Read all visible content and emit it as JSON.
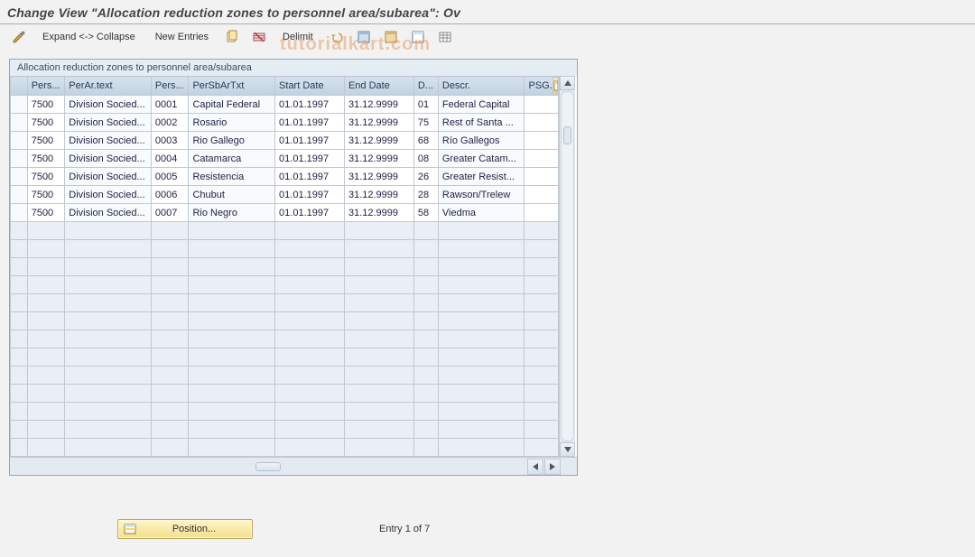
{
  "header": {
    "title": "Change View \"Allocation reduction zones to personnel area/subarea\": Ov"
  },
  "watermark": "tutorialkart.com",
  "toolbar": {
    "expand_collapse": "Expand <-> Collapse",
    "new_entries": "New Entries",
    "delimit": "Delimit"
  },
  "panel": {
    "title": "Allocation reduction zones to personnel area/subarea"
  },
  "columns": [
    {
      "key": "pers_area",
      "label": "Pers..."
    },
    {
      "key": "per_ar_text",
      "label": "PerAr.text"
    },
    {
      "key": "pers_sub",
      "label": "Pers..."
    },
    {
      "key": "per_sb_ar_txt",
      "label": "PerSbArTxt"
    },
    {
      "key": "start_date",
      "label": "Start Date"
    },
    {
      "key": "end_date",
      "label": "End Date"
    },
    {
      "key": "d",
      "label": "D..."
    },
    {
      "key": "descr",
      "label": "Descr."
    },
    {
      "key": "psg",
      "label": "PSG."
    }
  ],
  "rows": [
    {
      "pers_area": "7500",
      "per_ar_text": "Division Socied...",
      "pers_sub": "0001",
      "per_sb_ar_txt": "Capital Federal",
      "start_date": "01.01.1997",
      "end_date": "31.12.9999",
      "d": "01",
      "descr": "Federal Capital",
      "psg": ""
    },
    {
      "pers_area": "7500",
      "per_ar_text": "Division Socied...",
      "pers_sub": "0002",
      "per_sb_ar_txt": "Rosario",
      "start_date": "01.01.1997",
      "end_date": "31.12.9999",
      "d": "75",
      "descr": "Rest of Santa ...",
      "psg": ""
    },
    {
      "pers_area": "7500",
      "per_ar_text": "Division Socied...",
      "pers_sub": "0003",
      "per_sb_ar_txt": "Rio Gallego",
      "start_date": "01.01.1997",
      "end_date": "31.12.9999",
      "d": "68",
      "descr": "Río Gallegos",
      "psg": ""
    },
    {
      "pers_area": "7500",
      "per_ar_text": "Division Socied...",
      "pers_sub": "0004",
      "per_sb_ar_txt": "Catamarca",
      "start_date": "01.01.1997",
      "end_date": "31.12.9999",
      "d": "08",
      "descr": "Greater Catam...",
      "psg": ""
    },
    {
      "pers_area": "7500",
      "per_ar_text": "Division Socied...",
      "pers_sub": "0005",
      "per_sb_ar_txt": "Resistencia",
      "start_date": "01.01.1997",
      "end_date": "31.12.9999",
      "d": "26",
      "descr": "Greater Resist...",
      "psg": ""
    },
    {
      "pers_area": "7500",
      "per_ar_text": "Division Socied...",
      "pers_sub": "0006",
      "per_sb_ar_txt": "Chubut",
      "start_date": "01.01.1997",
      "end_date": "31.12.9999",
      "d": "28",
      "descr": "Rawson/Trelew",
      "psg": ""
    },
    {
      "pers_area": "7500",
      "per_ar_text": "Division Socied...",
      "pers_sub": "0007",
      "per_sb_ar_txt": "Rio Negro",
      "start_date": "01.01.1997",
      "end_date": "31.12.9999",
      "d": "58",
      "descr": "Viedma",
      "psg": ""
    }
  ],
  "empty_rows": 13,
  "footer": {
    "position_label": "Position...",
    "entry_text": "Entry 1 of 7"
  }
}
